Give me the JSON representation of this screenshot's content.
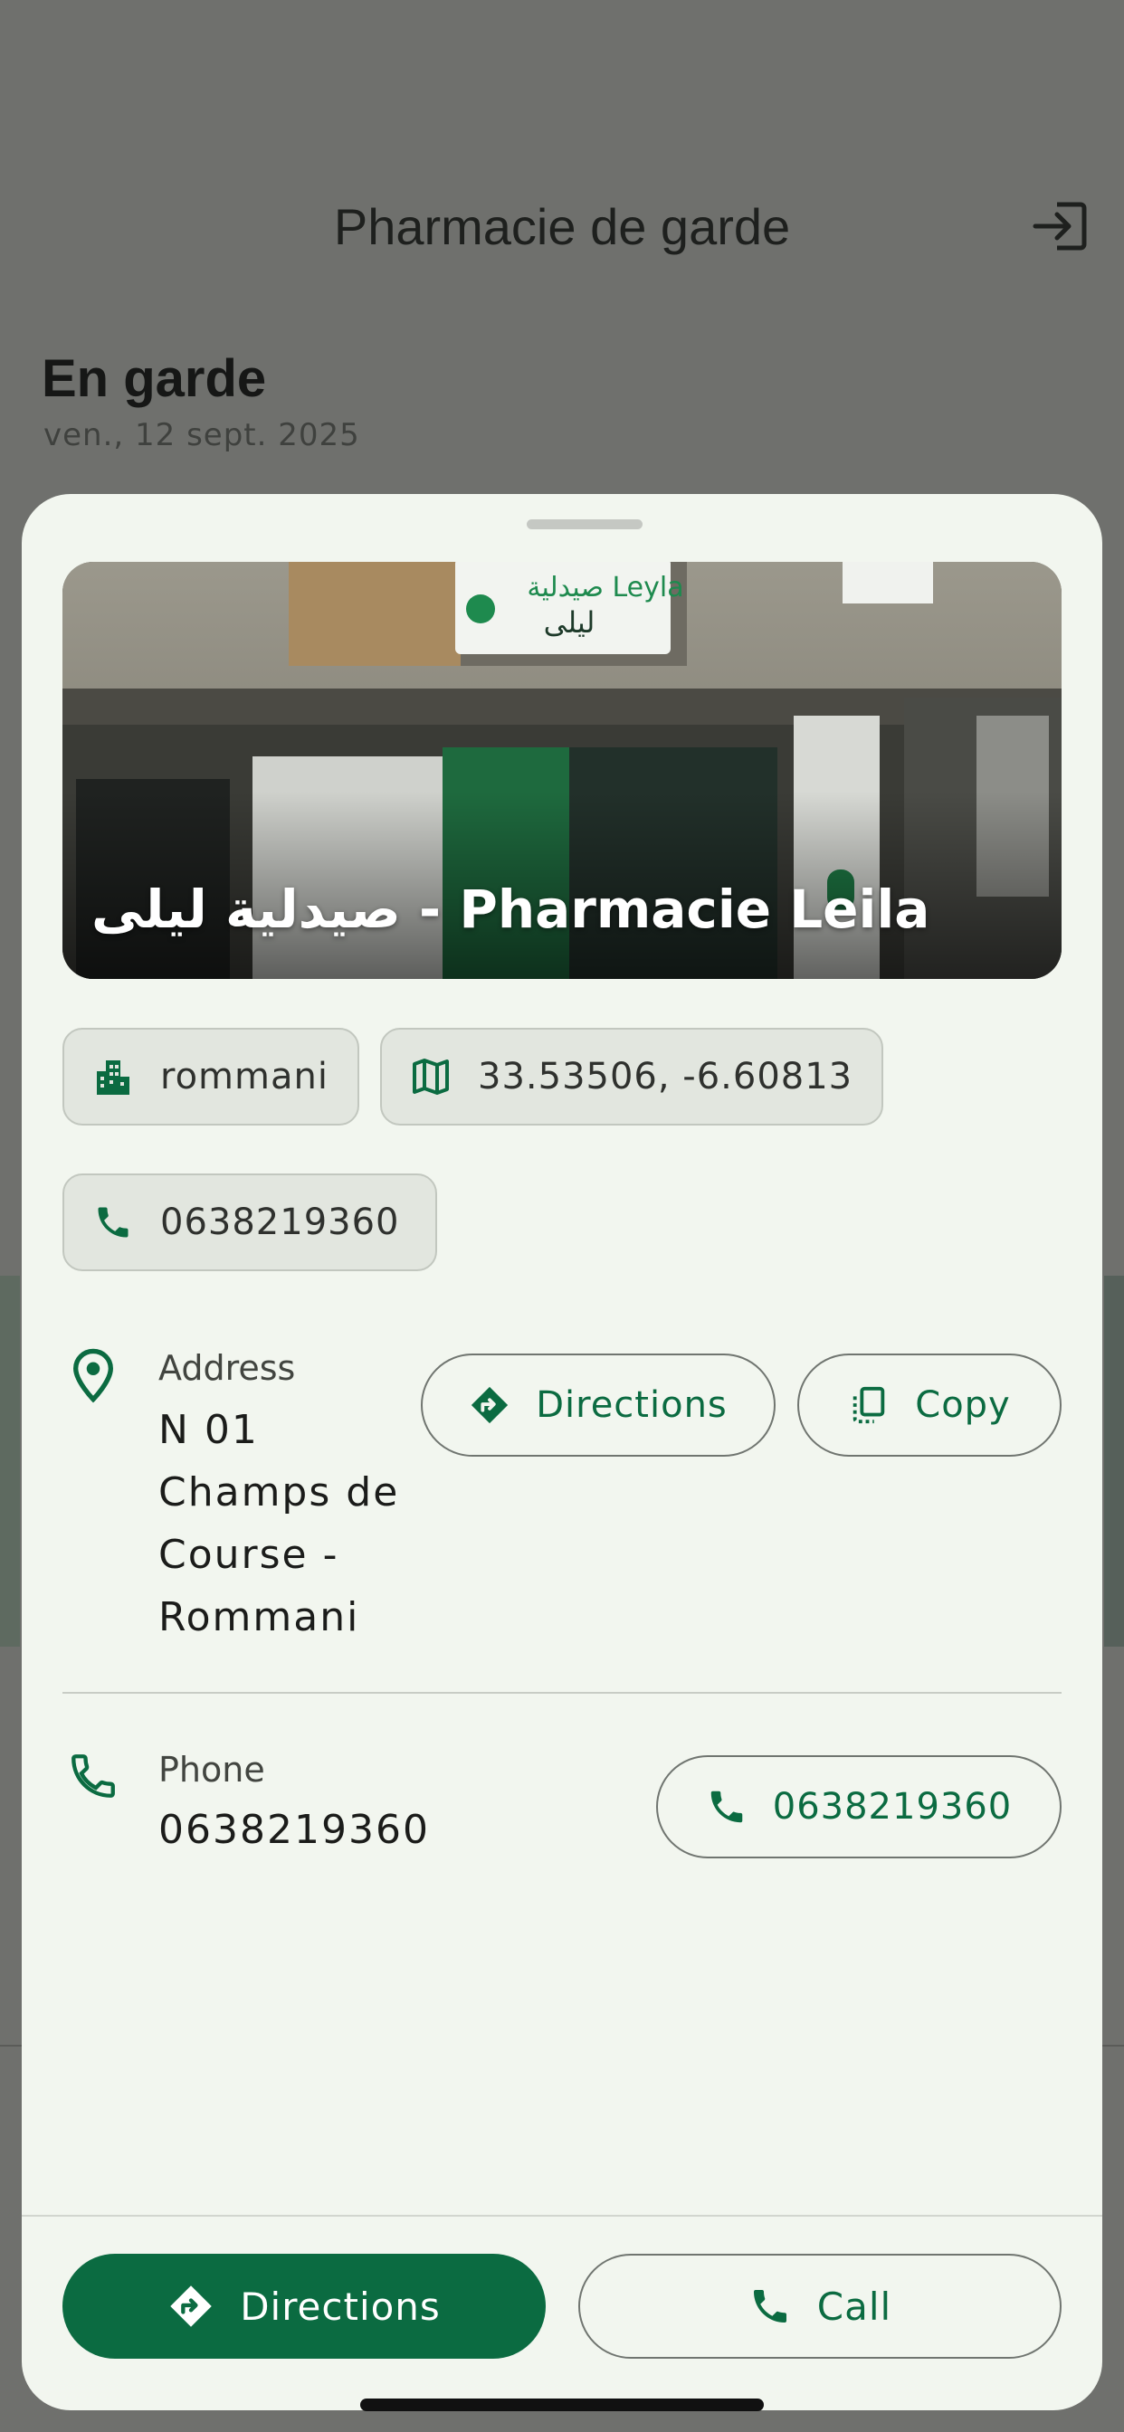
{
  "background": {
    "app_title": "Pharmacie de garde",
    "section_heading": "En garde",
    "date": "ven., 12 sept. 2025"
  },
  "sheet": {
    "pharmacy_name": "صيدلية ليلى - Pharmacie Leila",
    "chips": {
      "district": "rommani",
      "coordinates": "33.53506, -6.60813",
      "phone": "0638219360"
    },
    "address": {
      "label": "Address",
      "lines": [
        "N 01",
        "Champs de",
        "Course -",
        "Rommani"
      ],
      "directions_label": "Directions",
      "copy_label": "Copy"
    },
    "phone": {
      "label": "Phone",
      "value": "0638219360",
      "button_label": "0638219360"
    },
    "footer": {
      "directions_label": "Directions",
      "call_label": "Call"
    }
  },
  "colors": {
    "brand_green": "#0b6b41",
    "sheet_bg": "#f2f6ef",
    "chip_bg": "#e2e6df",
    "scrim": "#6f706d"
  },
  "icons": {
    "logout": "logout-icon",
    "district": "city-icon",
    "coordinates": "map-icon",
    "phone": "phone-icon",
    "location": "location-pin-icon",
    "directions": "directions-icon",
    "copy": "copy-icon"
  }
}
